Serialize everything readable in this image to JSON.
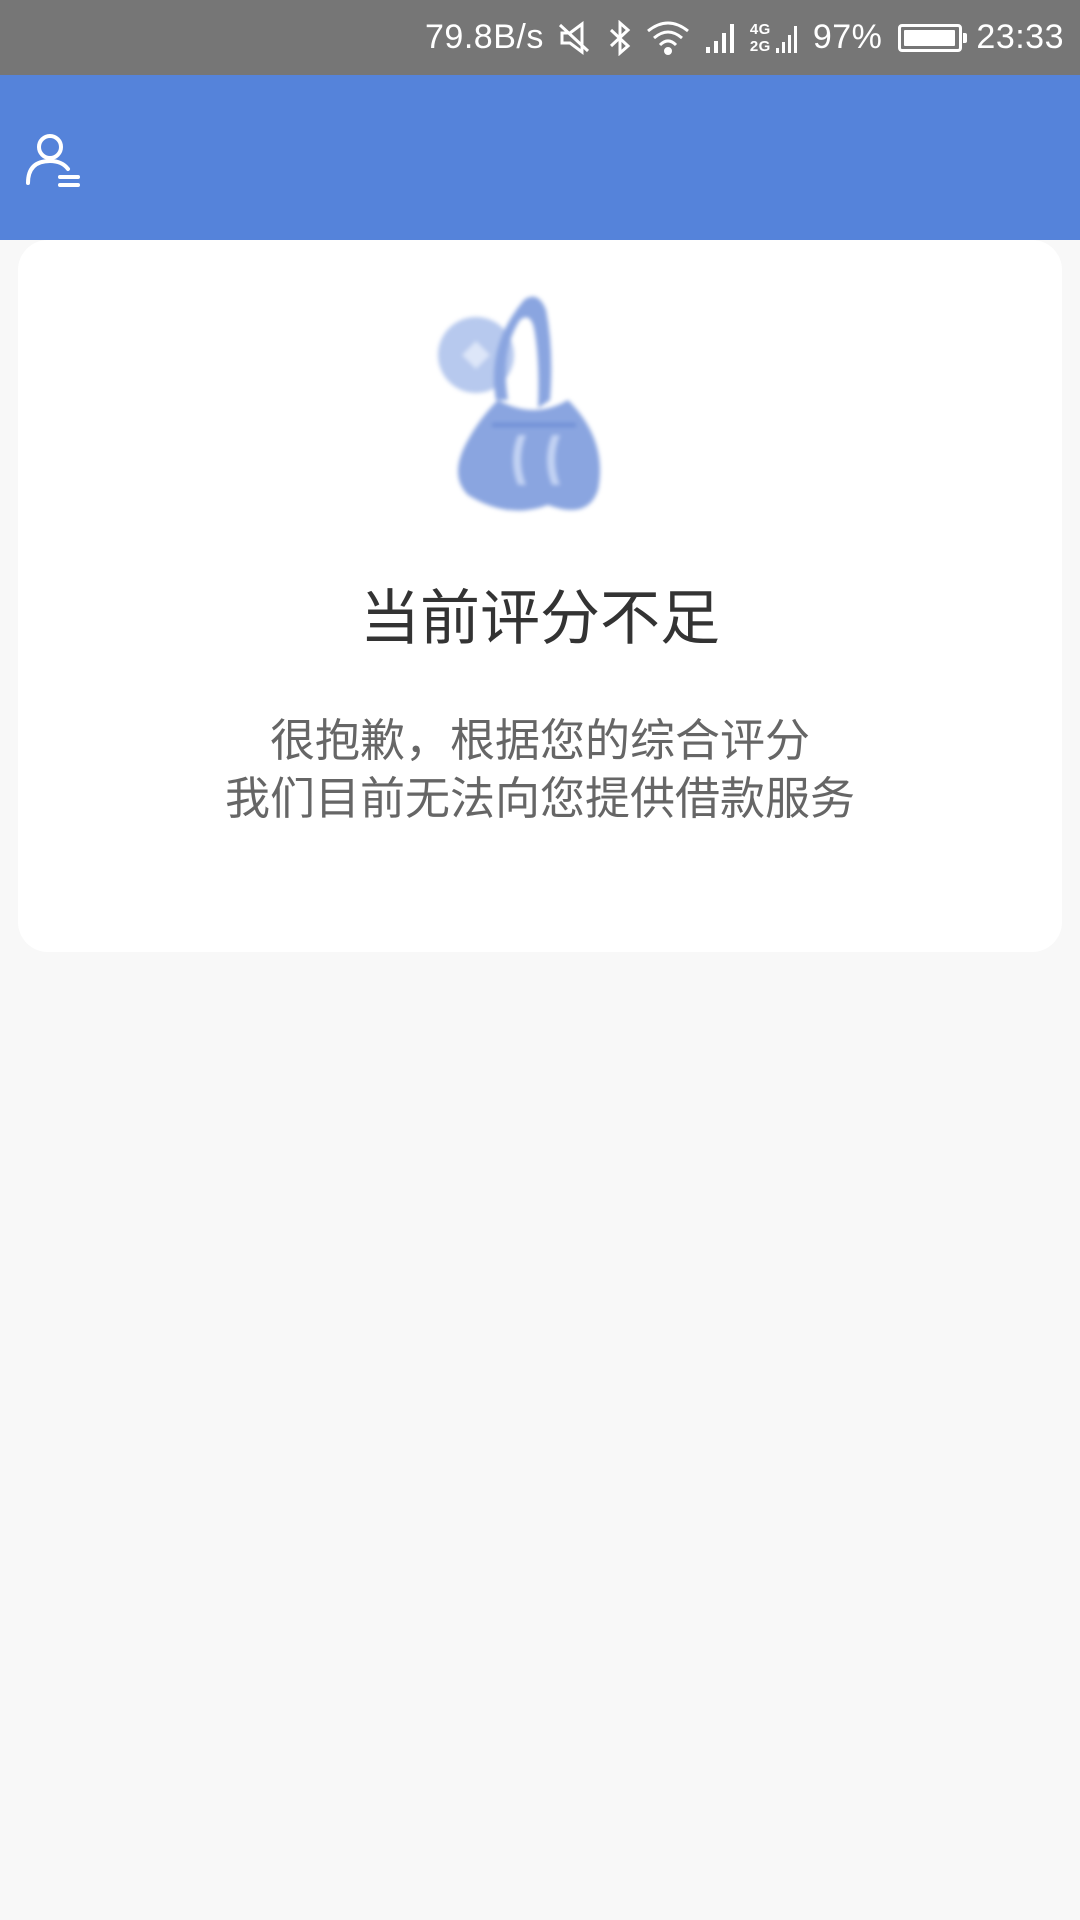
{
  "status_bar": {
    "net_speed": "79.8B/s",
    "net_type_top": "4G",
    "net_type_bottom": "2G",
    "battery_percent": "97%",
    "battery_level": 0.97,
    "time": "23:33",
    "icons": [
      "mute-icon",
      "bluetooth-icon",
      "wifi-icon",
      "signal-icon",
      "battery-icon"
    ]
  },
  "app_bar": {
    "icon": "user-menu-icon",
    "background_color": "#5583da"
  },
  "result": {
    "illustration_icon": "sad-money-bag-icon",
    "title": "当前评分不足",
    "message_lines": [
      "很抱歉，根据您的综合评分",
      "我们目前无法向您提供借款服务"
    ]
  }
}
